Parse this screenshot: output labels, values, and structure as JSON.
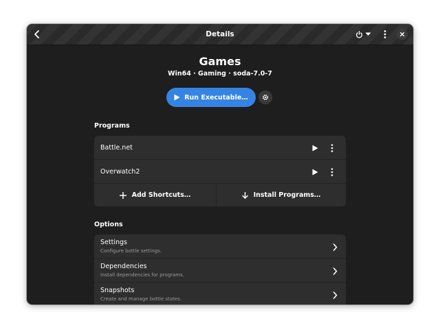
{
  "header": {
    "title": "Details",
    "icons": {
      "back": "chevron-left-icon",
      "power": "power-icon",
      "power_menu": "caret-down-icon",
      "menu": "vertical-dots-icon",
      "close": "close-icon"
    }
  },
  "bottle": {
    "name": "Games",
    "subtitle": "Win64 · Gaming · soda-7.0-7"
  },
  "run": {
    "label": "Run Executable…",
    "icon": "play-icon",
    "settings_icon": "gear-icon"
  },
  "programs": {
    "heading": "Programs",
    "items": [
      {
        "name": "Battle.net"
      },
      {
        "name": "Overwatch2"
      }
    ],
    "add_shortcuts_label": "Add Shortcuts…",
    "install_programs_label": "Install Programs…"
  },
  "options": {
    "heading": "Options",
    "items": [
      {
        "title": "Settings",
        "subtitle": "Configure bottle settings."
      },
      {
        "title": "Dependencies",
        "subtitle": "Install dependencies for programs."
      },
      {
        "title": "Snapshots",
        "subtitle": "Create and manage bottle states."
      }
    ]
  },
  "colors": {
    "accent": "#3584e4",
    "window_bg": "#1e1e1e",
    "card_bg": "#2e2e2e",
    "text": "#ffffff",
    "dim_text": "#9a9a9a"
  }
}
